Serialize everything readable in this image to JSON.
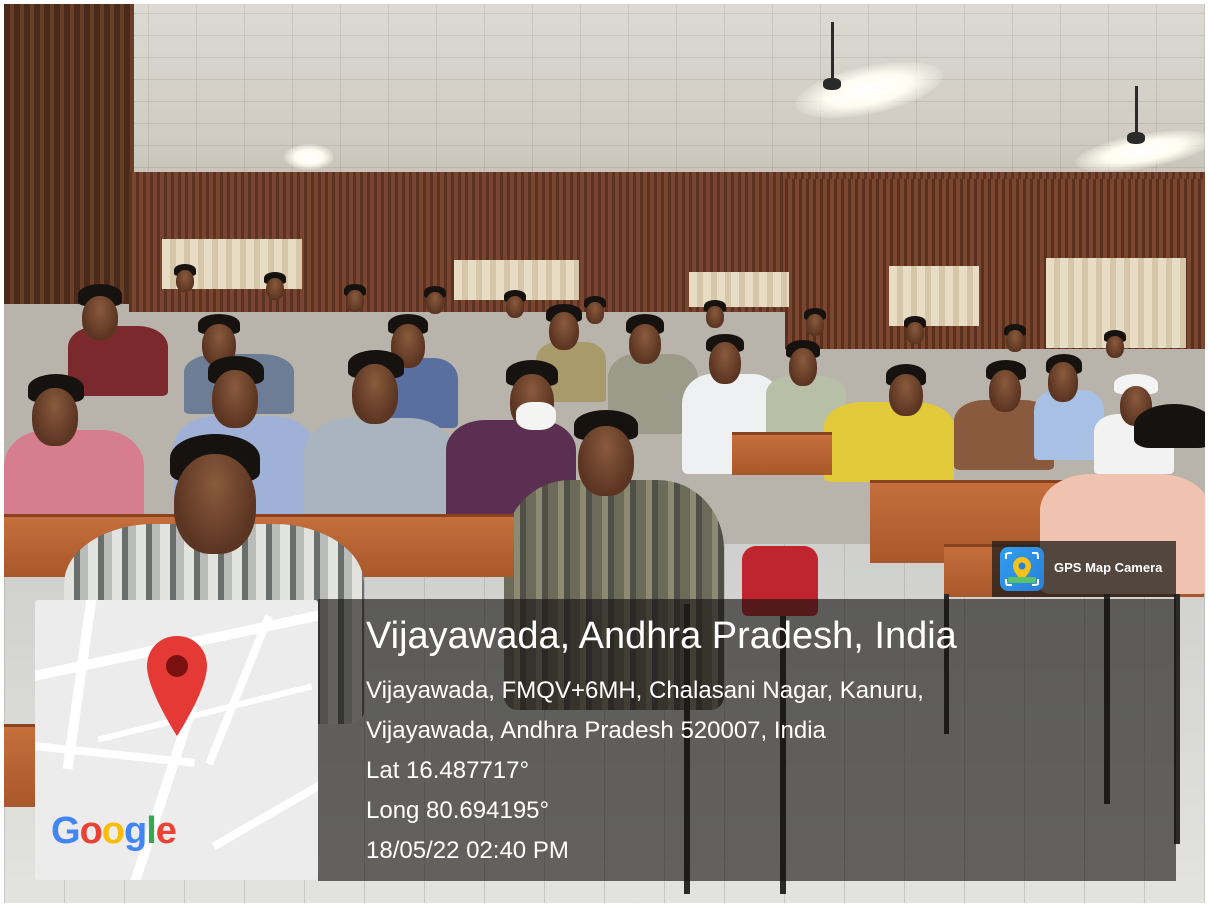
{
  "overlay": {
    "location_title": "Vijayawada, Andhra Pradesh, India",
    "address_line_1": "Vijayawada, FMQV+6MH, Chalasani Nagar, Kanuru,",
    "address_line_2": "Vijayawada, Andhra Pradesh 520007, India",
    "latitude": "Lat 16.487717°",
    "longitude": "Long 80.694195°",
    "datetime": "18/05/22 02:40 PM"
  },
  "camera_badge": {
    "label": "GPS Map Camera",
    "icon": "gps-map-camera-icon"
  },
  "map": {
    "logo": "Google",
    "logo_colors": [
      "#4285F4",
      "#EA4335",
      "#FBBC05",
      "#4285F4",
      "#34A853",
      "#EA4335"
    ],
    "pin_color": "#E53935",
    "icon": "map-pin-icon"
  }
}
